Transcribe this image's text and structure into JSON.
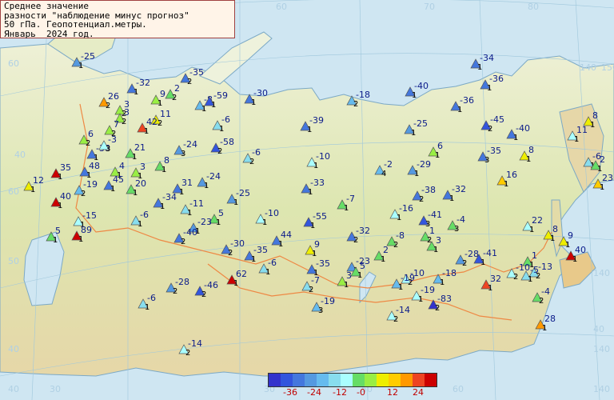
{
  "title": {
    "line1": "Среднее значение",
    "line2": "разности \"наблюдение минус прогноз\"",
    "line3": "50 гПа. Геопотенциал.метры.",
    "line4": "Январь  2024 год."
  },
  "legend": {
    "colors": [
      "#3333cc",
      "#3355dd",
      "#4477dd",
      "#5599e0",
      "#66bbee",
      "#88ddee",
      "#aaffff",
      "#66dd66",
      "#99ee44",
      "#eeee00",
      "#ffcc00",
      "#ff9900",
      "#ee4422",
      "#cc0000"
    ],
    "labels": [
      "-36",
      "-24",
      "-12",
      "-0",
      "12",
      "24"
    ]
  },
  "grid_labels": [
    "60",
    "70",
    "80",
    "60",
    "140",
    "150",
    "40",
    "60",
    "50",
    "140",
    "40",
    "30",
    "40",
    "140",
    "140",
    "60",
    "50",
    "30",
    "40"
  ],
  "stations": [
    {
      "v": "-25",
      "n": "1",
      "c": "#5599e0"
    },
    {
      "v": "-35",
      "n": "2",
      "c": "#4477dd"
    },
    {
      "v": "-32",
      "n": "1",
      "c": "#4477dd"
    },
    {
      "v": "26",
      "n": "2",
      "c": "#ff9900"
    },
    {
      "v": "3",
      "n": "2",
      "c": "#99ee44"
    },
    {
      "v": "9",
      "n": "1",
      "c": "#99ee44"
    },
    {
      "v": "2",
      "n": "2",
      "c": "#66dd66"
    },
    {
      "v": "-8",
      "n": "1",
      "c": "#66bbee"
    },
    {
      "v": "-59",
      "n": "1",
      "c": "#3355dd"
    },
    {
      "v": "-30",
      "n": "1",
      "c": "#4477dd"
    },
    {
      "v": "-18",
      "n": "2",
      "c": "#66bbee"
    },
    {
      "v": "-40",
      "n": "1",
      "c": "#4477dd"
    },
    {
      "v": "-36",
      "n": "1",
      "c": "#4477dd"
    },
    {
      "v": "-34",
      "n": "1",
      "c": "#4477dd"
    },
    {
      "v": "-36",
      "n": "1",
      "c": "#4477dd"
    },
    {
      "v": "11",
      "n": "2",
      "c": "#eeee00"
    },
    {
      "v": "42",
      "n": "1",
      "c": "#ee4422"
    },
    {
      "v": "3",
      "n": "2",
      "c": "#99ee44"
    },
    {
      "v": "7",
      "n": "2",
      "c": "#99ee44"
    },
    {
      "v": "6",
      "n": "2",
      "c": "#99ee44"
    },
    {
      "v": "-38",
      "n": "1",
      "c": "#4477dd"
    },
    {
      "v": "-3",
      "n": "3",
      "c": "#aaffff"
    },
    {
      "v": "-6",
      "n": "1",
      "c": "#88ddee"
    },
    {
      "v": "-39",
      "n": "1",
      "c": "#4477dd"
    },
    {
      "v": "-25",
      "n": "1",
      "c": "#5599e0"
    },
    {
      "v": "-45",
      "n": "2",
      "c": "#3355dd"
    },
    {
      "v": "-40",
      "n": "1",
      "c": "#4477dd"
    },
    {
      "v": "8",
      "n": "1",
      "c": "#eeee00"
    },
    {
      "v": "21",
      "n": "1",
      "c": "#66dd66"
    },
    {
      "v": "48",
      "n": "1",
      "c": "#4477dd"
    },
    {
      "v": "8",
      "n": "1",
      "c": "#66dd66"
    },
    {
      "v": "-24",
      "n": "3",
      "c": "#5599e0"
    },
    {
      "v": "-58",
      "n": "2",
      "c": "#3355dd"
    },
    {
      "v": "-6",
      "n": "2",
      "c": "#88ddee"
    },
    {
      "v": "-10",
      "n": "1",
      "c": "#aaffff"
    },
    {
      "v": "6",
      "n": "1",
      "c": "#99ee44"
    },
    {
      "v": "-35",
      "n": "3",
      "c": "#4477dd"
    },
    {
      "v": "8",
      "n": "1",
      "c": "#eeee00"
    },
    {
      "v": "11",
      "n": "1",
      "c": "#aaffff"
    },
    {
      "v": "-6",
      "n": "1",
      "c": "#88ddee"
    },
    {
      "v": "2",
      "n": "1",
      "c": "#66dd66"
    },
    {
      "v": "35",
      "n": "1",
      "c": "#cc0000"
    },
    {
      "v": "4",
      "n": "1",
      "c": "#99ee44"
    },
    {
      "v": "3",
      "n": "1",
      "c": "#99ee44"
    },
    {
      "v": "-2",
      "n": "4",
      "c": "#66bbee"
    },
    {
      "v": "-29",
      "n": "1",
      "c": "#5599e0"
    },
    {
      "v": "16",
      "n": "1",
      "c": "#ffcc00"
    },
    {
      "v": "23",
      "n": "1",
      "c": "#ffcc00"
    },
    {
      "v": "12",
      "n": "1",
      "c": "#eeee00"
    },
    {
      "v": "-19",
      "n": "2",
      "c": "#66bbee"
    },
    {
      "v": "45",
      "n": "1",
      "c": "#4477dd"
    },
    {
      "v": "20",
      "n": "1",
      "c": "#66dd66"
    },
    {
      "v": "31",
      "n": "1",
      "c": "#4477dd"
    },
    {
      "v": "-24",
      "n": "1",
      "c": "#5599e0"
    },
    {
      "v": "-33",
      "n": "1",
      "c": "#4477dd"
    },
    {
      "v": "-38",
      "n": "2",
      "c": "#4477dd"
    },
    {
      "v": "-32",
      "n": "1",
      "c": "#4477dd"
    },
    {
      "v": "40",
      "n": "1",
      "c": "#cc0000"
    },
    {
      "v": "-34",
      "n": "1",
      "c": "#4477dd"
    },
    {
      "v": "-25",
      "n": "1",
      "c": "#5599e0"
    },
    {
      "v": "-7",
      "n": "1",
      "c": "#66dd66"
    },
    {
      "v": "-11",
      "n": "1",
      "c": "#88ddee"
    },
    {
      "v": "-16",
      "n": "1",
      "c": "#aaffff"
    },
    {
      "v": "-41",
      "n": "3",
      "c": "#3355dd"
    },
    {
      "v": "-4",
      "n": "3",
      "c": "#66dd66"
    },
    {
      "v": "22",
      "n": "1",
      "c": "#aaffff"
    },
    {
      "v": "5",
      "n": "1",
      "c": "#66dd66"
    },
    {
      "v": "-15",
      "n": "1",
      "c": "#aaffff"
    },
    {
      "v": "-6",
      "n": "1",
      "c": "#88ddee"
    },
    {
      "v": "-23",
      "n": "1",
      "c": "#5599e0"
    },
    {
      "v": "-10",
      "n": "1",
      "c": "#aaffff"
    },
    {
      "v": "-55",
      "n": "1",
      "c": "#3355dd"
    },
    {
      "v": "8",
      "n": "1",
      "c": "#eeee00"
    },
    {
      "v": "9",
      "n": "1",
      "c": "#eeee00"
    },
    {
      "v": "5",
      "n": "1",
      "c": "#66dd66"
    },
    {
      "v": "89",
      "n": "1",
      "c": "#cc0000"
    },
    {
      "v": "-40",
      "n": "2",
      "c": "#4477dd"
    },
    {
      "v": "44",
      "n": "1",
      "c": "#4477dd"
    },
    {
      "v": "-32",
      "n": "2",
      "c": "#4477dd"
    },
    {
      "v": "-8",
      "n": "2",
      "c": "#66dd66"
    },
    {
      "v": "40",
      "n": "1",
      "c": "#cc0000"
    },
    {
      "v": "1",
      "n": "2",
      "c": "#66dd66"
    },
    {
      "v": "-30",
      "n": "2",
      "c": "#4477dd"
    },
    {
      "v": "-28",
      "n": "2",
      "c": "#5599e0"
    },
    {
      "v": "9",
      "n": "1",
      "c": "#eeee00"
    },
    {
      "v": "-35",
      "n": "1",
      "c": "#4477dd"
    },
    {
      "v": "2",
      "n": "1",
      "c": "#66dd66"
    },
    {
      "v": "-41",
      "n": "1",
      "c": "#3355dd"
    },
    {
      "v": "1",
      "n": "1",
      "c": "#66dd66"
    },
    {
      "v": "-6",
      "n": "1",
      "c": "#88ddee"
    },
    {
      "v": "-23",
      "n": "1",
      "c": "#5599e0"
    },
    {
      "v": "-35",
      "n": "1",
      "c": "#4477dd"
    },
    {
      "v": "5",
      "n": "1",
      "c": "#66dd66"
    },
    {
      "v": "-10",
      "n": "2",
      "c": "#aaffff"
    },
    {
      "v": "-18",
      "n": "1",
      "c": "#66bbee"
    },
    {
      "v": "-10",
      "n": "2",
      "c": "#aaffff"
    },
    {
      "v": "-13",
      "n": "2",
      "c": "#88ddee"
    },
    {
      "v": "62",
      "n": "1",
      "c": "#cc0000"
    },
    {
      "v": "-46",
      "n": "2",
      "c": "#3355dd"
    },
    {
      "v": "-28",
      "n": "2",
      "c": "#5599e0"
    },
    {
      "v": "-7",
      "n": "2",
      "c": "#88ddee"
    },
    {
      "v": "3",
      "n": "1",
      "c": "#99ee44"
    },
    {
      "v": "-19",
      "n": "1",
      "c": "#66bbee"
    },
    {
      "v": "-19",
      "n": "1",
      "c": "#aaffff"
    },
    {
      "v": "32",
      "n": "1",
      "c": "#ee4422"
    },
    {
      "v": "-4",
      "n": "2",
      "c": "#66dd66"
    },
    {
      "v": "-6",
      "n": "1",
      "c": "#88ddee"
    },
    {
      "v": "-19",
      "n": "3",
      "c": "#66bbee"
    },
    {
      "v": "-14",
      "n": "2",
      "c": "#aaffff"
    },
    {
      "v": "-83",
      "n": "2",
      "c": "#3333cc"
    },
    {
      "v": "28",
      "n": "1",
      "c": "#ff9900"
    },
    {
      "v": "-14",
      "n": "2",
      "c": "#aaffff"
    },
    {
      "v": "-5",
      "n": "1",
      "c": "#88ddee"
    },
    {
      "v": "3",
      "n": "1",
      "c": "#66dd66"
    }
  ]
}
